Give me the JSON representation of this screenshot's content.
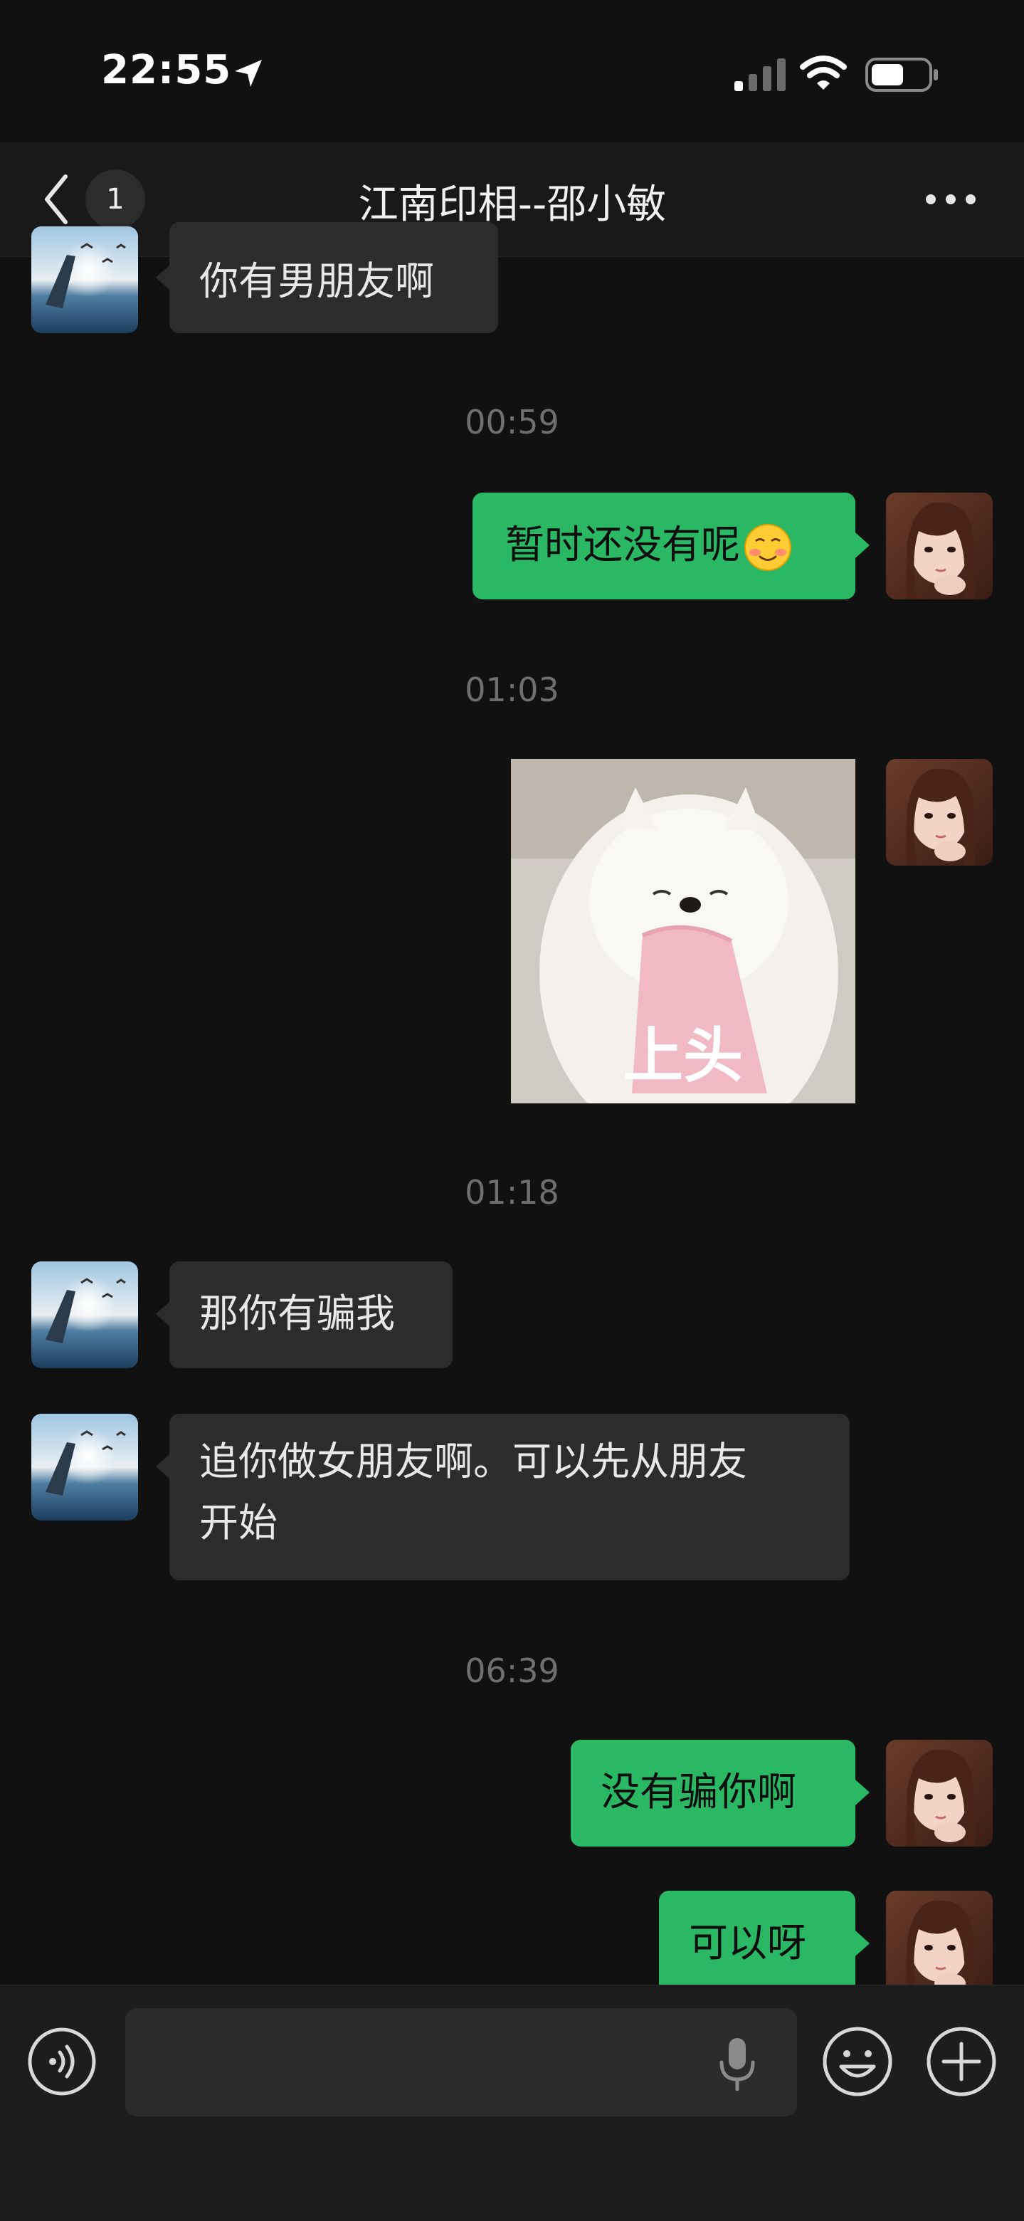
{
  "status_bar": {
    "time": "22:55"
  },
  "header": {
    "back_badge": "1",
    "title": "江南印相--邵小敏"
  },
  "messages": [
    {
      "kind": "text",
      "side": "in",
      "text": "你有男朋友啊"
    },
    {
      "kind": "time",
      "text": "00:59"
    },
    {
      "kind": "text",
      "side": "out",
      "text": "暂时还没有呢"
    },
    {
      "kind": "time",
      "text": "01:03"
    },
    {
      "kind": "sticker",
      "side": "out",
      "caption": "上头"
    },
    {
      "kind": "time",
      "text": "01:18"
    },
    {
      "kind": "text",
      "side": "in",
      "text": "那你有骗我"
    },
    {
      "kind": "text",
      "side": "in",
      "line1": "追你做女朋友啊。可以先从朋友",
      "line2": "开始"
    },
    {
      "kind": "time",
      "text": "06:39"
    },
    {
      "kind": "text",
      "side": "out",
      "text": "没有骗你啊"
    },
    {
      "kind": "text",
      "side": "out",
      "text": "可以呀"
    }
  ],
  "input_bar": {
    "placeholder": ""
  },
  "icons": [
    "location-arrow-icon",
    "signal-icon",
    "wifi-icon",
    "battery-icon",
    "back-icon",
    "more-icon",
    "voice-icon",
    "mic-icon",
    "emoji-icon",
    "plus-icon",
    "blush-smile-emoji"
  ],
  "colors": {
    "background": "#111111",
    "incoming_bubble": "#2c2c2c",
    "outgoing_bubble": "#2ab864",
    "timestamp": "#6f6f6f"
  }
}
